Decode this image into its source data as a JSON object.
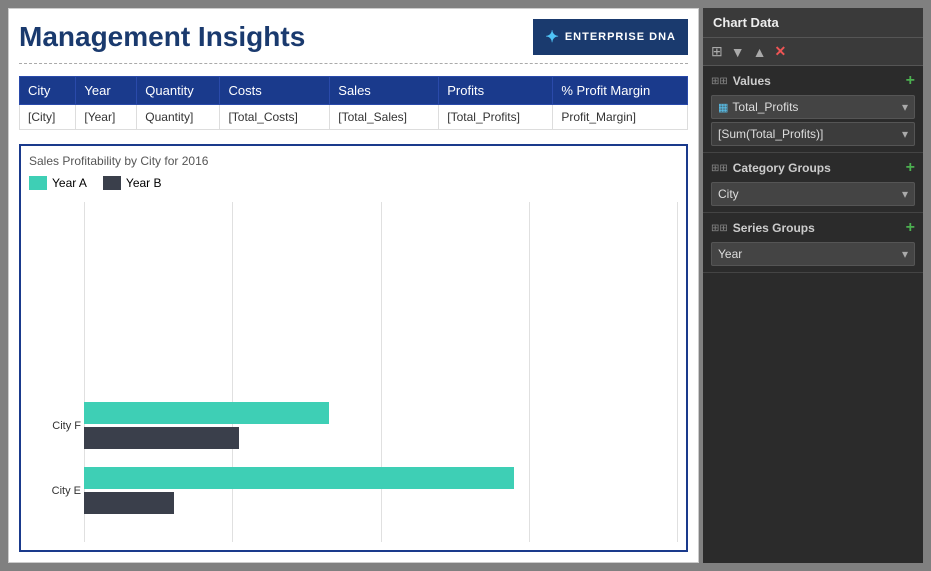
{
  "header": {
    "title": "Management Insights",
    "logo_text": "ENTERPRISE DNA",
    "logo_icon": "✦"
  },
  "table": {
    "columns": [
      "City",
      "Year",
      "Quantity",
      "Costs",
      "Sales",
      "Profits",
      "% Profit Margin"
    ],
    "row": [
      "[City]",
      "[Year]",
      "Quantity]",
      "[Total_Costs]",
      "[Total_Sales]",
      "[Total_Profits]",
      "Profit_Margin]"
    ]
  },
  "chart": {
    "title": "Sales Profitability by City for 2016",
    "legend": [
      {
        "label": "Year A",
        "color": "#3ecfb5"
      },
      {
        "label": "Year B",
        "color": "#3a3f4b"
      }
    ],
    "groups": [
      {
        "label": "City F",
        "barA_width": 245,
        "barB_width": 155
      },
      {
        "label": "City E",
        "barA_width": 430,
        "barB_width": 90
      }
    ]
  },
  "sidebar": {
    "title": "Chart Data",
    "icons": [
      "grid-icon",
      "down-arrow-icon",
      "up-arrow-icon",
      "close-icon"
    ],
    "values_section": {
      "label": "Values",
      "add_icon": "+",
      "field1": "Total_Profits",
      "field1_formula": "[Sum(Total_Profits)]"
    },
    "category_section": {
      "label": "Category Groups",
      "add_icon": "+",
      "field": "City"
    },
    "series_section": {
      "label": "Series Groups",
      "add_icon": "+",
      "field": "Year"
    }
  }
}
